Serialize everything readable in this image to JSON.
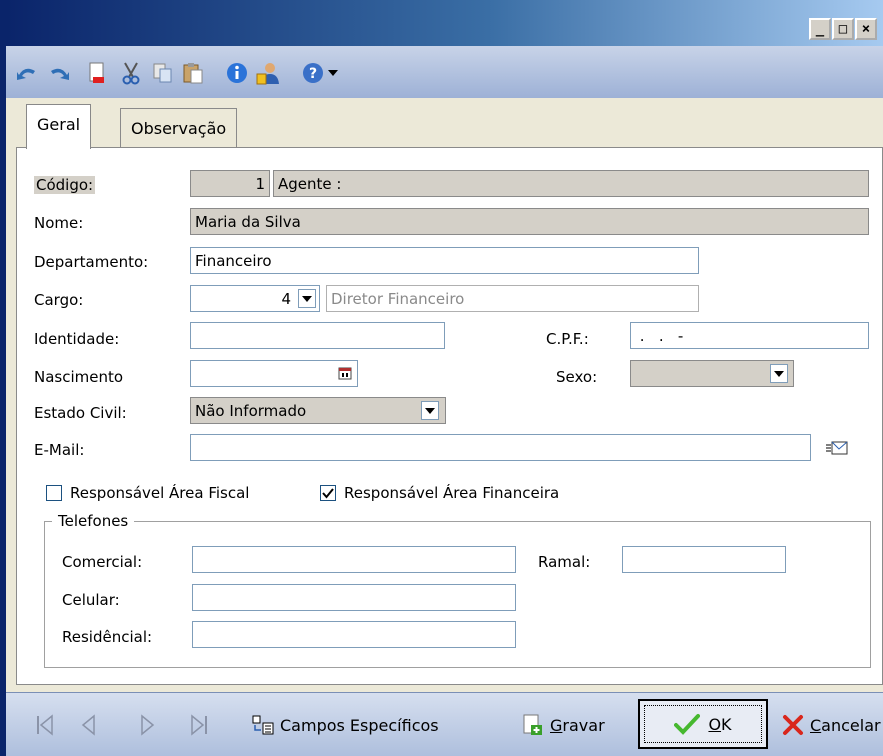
{
  "titlebar": {
    "controls": {
      "minimize": "_",
      "maximize": "□",
      "close": "×"
    }
  },
  "toolbar": {
    "icons": [
      "undo-icon",
      "redo-icon",
      "new-document-icon",
      "cut-icon",
      "copy-icon",
      "paste-icon",
      "info-icon",
      "user-icon",
      "help-icon",
      "dropdown-arrow-icon"
    ]
  },
  "tabs": [
    {
      "label": "Geral",
      "active": true
    },
    {
      "label": "Observação",
      "active": false
    }
  ],
  "form": {
    "codigo_label": "Código:",
    "codigo_value": "1",
    "agente_label": "Agente :",
    "nome_label": "Nome:",
    "nome_value": "Maria da Silva",
    "departamento_label": "Departamento:",
    "departamento_value": "Financeiro",
    "cargo_label": "Cargo:",
    "cargo_code": "4",
    "cargo_desc": "Diretor Financeiro",
    "identidade_label": "Identidade:",
    "identidade_value": "",
    "cpf_label": "C.P.F.:",
    "cpf_value": " .   .   -",
    "nascimento_label": "Nascimento",
    "nascimento_value": "",
    "sexo_label": "Sexo:",
    "sexo_value": "",
    "estado_civil_label": "Estado Civil:",
    "estado_civil_value": "Não Informado",
    "email_label": "E-Mail:",
    "email_value": "",
    "resp_fiscal_label": "Responsável Área Fiscal",
    "resp_fiscal_checked": false,
    "resp_financeira_label": "Responsável Área Financeira",
    "resp_financeira_checked": true
  },
  "telefones": {
    "legend": "Telefones",
    "comercial_label": "Comercial:",
    "comercial_value": "",
    "ramal_label": "Ramal:",
    "ramal_value": "",
    "celular_label": "Celular:",
    "celular_value": "",
    "residencial_label": "Residêncial:",
    "residencial_value": ""
  },
  "bottombar": {
    "campos_label": "Campos Específicos",
    "gravar_label": "Gravar",
    "ok_label": "OK",
    "cancelar_label": "Cancelar"
  },
  "colors": {
    "title_blue": "#0a246a",
    "field_border": "#7f9db9",
    "ok_green": "#46b82f",
    "cancel_red": "#d9261c"
  }
}
